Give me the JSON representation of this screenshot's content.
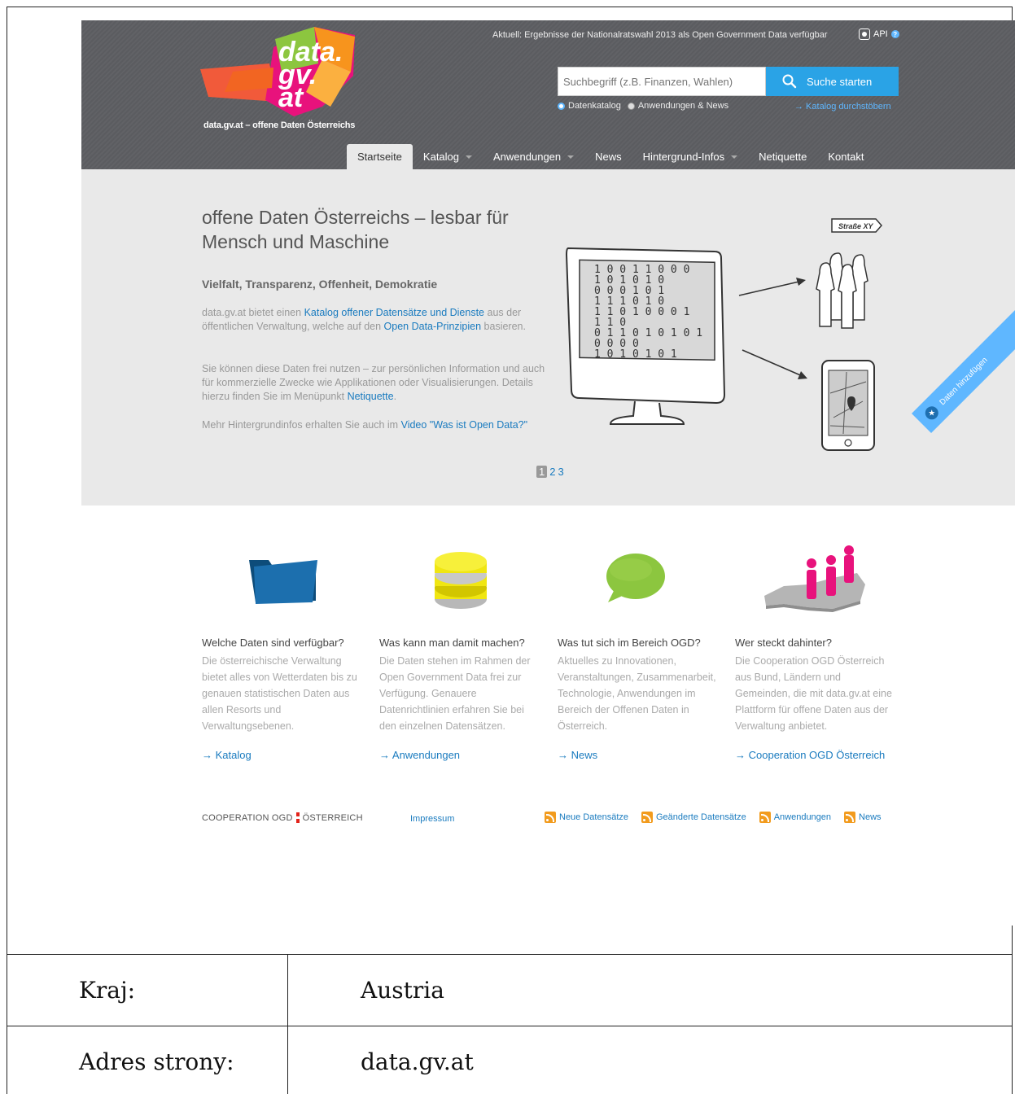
{
  "header": {
    "logo_text_1": "data.",
    "logo_text_2": "gv.",
    "logo_text_3": "at",
    "logo_caption": "data.gv.at – offene Daten Österreichs",
    "ticker": "Aktuell: Ergebnisse der Nationalratswahl 2013 als Open Government Data verfügbar",
    "api_label": "API",
    "search_placeholder": "Suchbegriff (z.B. Finanzen, Wahlen)",
    "search_button": "Suche starten",
    "radio_1": "Datenkatalog",
    "radio_2": "Anwendungen & News",
    "browse_link": "→ Katalog durchstöbern"
  },
  "nav": {
    "startseite": "Startseite",
    "katalog": "Katalog",
    "anwendungen": "Anwendungen",
    "news": "News",
    "hintergrund": "Hintergrund-Infos",
    "netiquette": "Netiquette",
    "kontakt": "Kontakt"
  },
  "hero": {
    "title": "offene Daten Österreichs – lesbar für Mensch und Maschine",
    "subtitle": "Vielfalt, Transparenz, Offenheit, Demokratie",
    "p1_a": "data.gv.at bietet einen ",
    "p1_link1": "Katalog offener Datensätze und Dienste",
    "p1_b": " aus der öffentlichen Verwaltung, welche auf den ",
    "p1_link2": "Open Data-Prinzipien",
    "p1_c": " basieren.",
    "p2_a": "Sie können diese Daten frei nutzen – zur persönlichen Information und auch für kommerzielle Zwecke wie Applikationen oder Visualisierungen. Details hierzu finden Sie im Menüpunkt ",
    "p2_link": "Netiquette",
    "p2_b": ".",
    "p3_a": "Mehr Hintergrundinfos erhalten Sie auch im ",
    "p3_link": "Video \"Was ist Open Data?\"",
    "sign_label": "Straße XY",
    "binary_rows": [
      "1  0  0 1  1 0 0  0",
      "  1 0      1  0 1 0",
      "0    0   0 1    0  1",
      "  1     1  1 0   1 0",
      "1 1 0  1  0  0 0  1",
      "    1    1        0",
      "0 1   1 0  1 0 1 0 1",
      " 0 0    0       0  ",
      "1   0  1 0 1  0 1"
    ],
    "pager_current": "1",
    "pager_2": "2",
    "pager_3": "3",
    "ribbon_label": "Daten hinzufügen"
  },
  "features": [
    {
      "title": "Welche Daten sind verfügbar?",
      "text": "Die österreichische Verwaltung bietet alles von Wetterdaten bis zu genauen statistischen Daten aus allen Resorts und Verwaltungsebenen.",
      "link": "→ Katalog"
    },
    {
      "title": "Was kann man damit machen?",
      "text": "Die Daten stehen im Rahmen der Open Government Data frei zur Verfügung. Genauere Datenrichtlinien erfahren Sie bei den einzelnen Datensätzen.",
      "link": "→ Anwendungen"
    },
    {
      "title": "Was tut sich im Bereich OGD?",
      "text": "Aktuelles zu Innovationen, Veranstaltungen, Zusammenarbeit, Technologie, Anwendungen im Bereich der Offenen Daten in Österreich.",
      "link": "→ News"
    },
    {
      "title": "Wer steckt dahinter?",
      "text": "Die Cooperation OGD Österreich aus Bund, Ländern und Gemeinden, die mit data.gv.at eine Plattform für offene Daten aus der Verwaltung anbietet.",
      "link": "→ Cooperation OGD Österreich"
    }
  ],
  "footer": {
    "brand_left": "COOPERATION OGD",
    "brand_right": "ÖSTERREICH",
    "impressum": "Impressum",
    "feed_1": "Neue Datensätze",
    "feed_2": "Geänderte Datensätze",
    "feed_3": "Anwendungen",
    "feed_4": "News"
  },
  "table": {
    "row1_key": "Kraj:",
    "row1_val": "Austria",
    "row2_key": "Adres strony:",
    "row2_val": "data.gv.at"
  },
  "colors": {
    "header_bg": "#5d5e62",
    "accent_blue": "#2aa3e6",
    "link_blue": "#1a7bbf",
    "hero_bg": "#e9e9e9"
  }
}
